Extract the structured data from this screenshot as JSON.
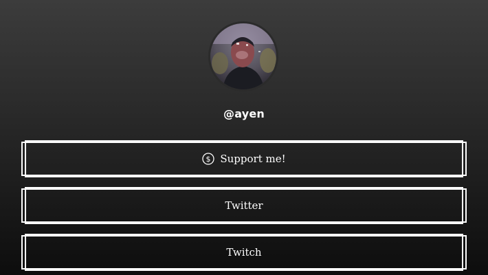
{
  "profile": {
    "username": "@ayen",
    "avatar_icon": "profile-photo"
  },
  "links": [
    {
      "label": "Support me!",
      "icon": "dollar-circle-icon"
    },
    {
      "label": "Twitter"
    },
    {
      "label": "Twitch"
    }
  ],
  "colors": {
    "background_top": "#3c3c3c",
    "background_bottom": "#0d0d0d",
    "button_border": "#ffffff",
    "text": "#ffffff"
  }
}
